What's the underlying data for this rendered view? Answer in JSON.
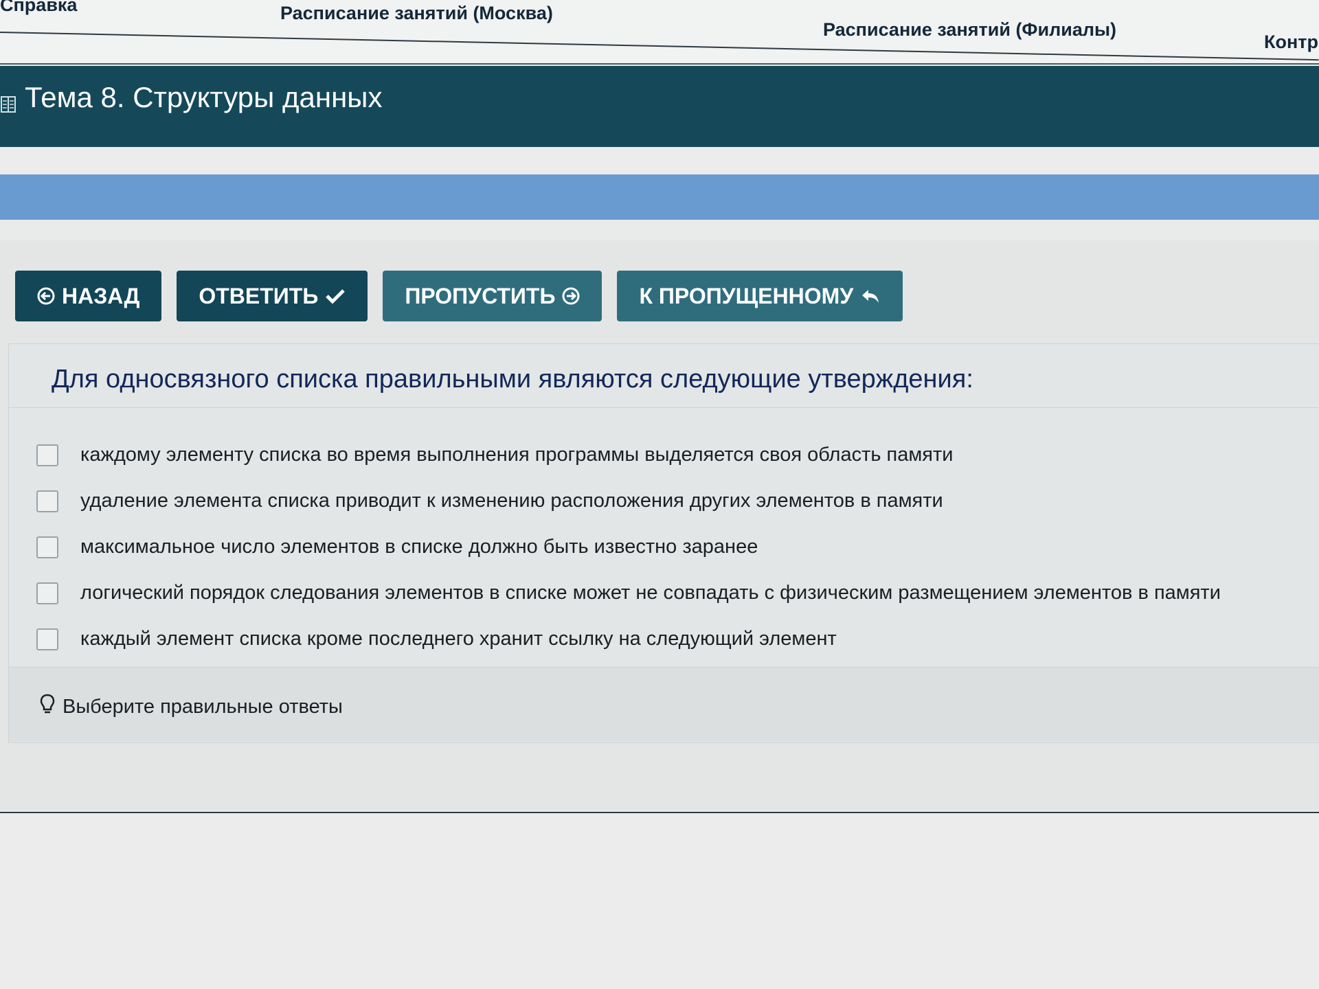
{
  "topnav": {
    "help": "Справка",
    "schedule_moscow": "Расписание занятий (Москва)",
    "schedule_branches": "Расписание занятий (Филиалы)",
    "control": "Контро"
  },
  "topic": {
    "title": "Тема 8. Структуры данных",
    "icon": "book-icon"
  },
  "progress": {
    "fraction": 1.0,
    "color": "#6a9bd0"
  },
  "toolbar": {
    "back": "НАЗАД",
    "answer": "ОТВЕТИТЬ",
    "skip": "ПРОПУСТИТЬ",
    "to_skipped": "К ПРОПУЩЕННОМУ"
  },
  "question": {
    "text": "Для односвязного списка правильными являются следующие утверждения:",
    "options": [
      {
        "label": "каждому элементу списка во время выполнения программы выделяется своя область памяти",
        "checked": false
      },
      {
        "label": "удаление элемента списка приводит к изменению расположения других элементов в памяти",
        "checked": false
      },
      {
        "label": "максимальное число элементов в списке должно быть известно заранее",
        "checked": false
      },
      {
        "label": "логический порядок следования элементов в списке может не совпадать с физическим размещением элементов в памяти",
        "checked": false
      },
      {
        "label": "каждый элемент списка кроме последнего хранит ссылку на следующий элемент",
        "checked": false
      }
    ]
  },
  "hint": {
    "text": "Выберите правильные ответы",
    "icon": "lightbulb-icon"
  },
  "colors": {
    "header": "#15495a",
    "button_primary": "#134657",
    "button_secondary": "#2f6d7d"
  }
}
